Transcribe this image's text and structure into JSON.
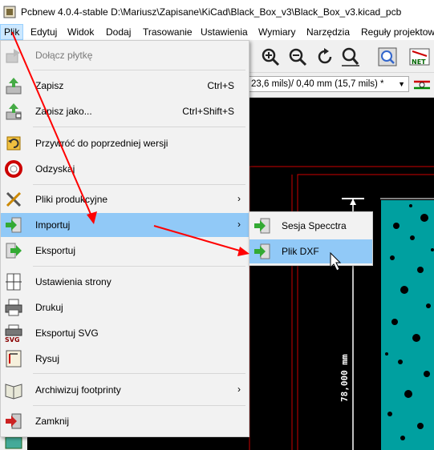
{
  "window": {
    "title": "Pcbnew 4.0.4-stable D:\\Mariusz\\Zapisane\\KiCad\\Black_Box_v3\\Black_Box_v3.kicad_pcb"
  },
  "menubar": [
    {
      "label": "Plik",
      "active": true
    },
    {
      "label": "Edytuj"
    },
    {
      "label": "Widok"
    },
    {
      "label": "Dodaj"
    },
    {
      "label": "Trasowanie"
    },
    {
      "label": "Ustawienia"
    },
    {
      "label": "Wymiary"
    },
    {
      "label": "Narzędzia"
    },
    {
      "label": "Reguły projektowe"
    }
  ],
  "toolbar": {
    "track_width_value": "23,6 mils)/ 0,40 mm (15,7 mils) *"
  },
  "file_menu": {
    "items": [
      {
        "label": "Dołącz płytkę",
        "icon": "append-board-icon",
        "disabled": true
      },
      {
        "label": "Zapisz",
        "shortcut": "Ctrl+S",
        "icon": "save-icon"
      },
      {
        "label": "Zapisz jako...",
        "shortcut": "Ctrl+Shift+S",
        "icon": "save-as-icon"
      },
      {
        "label": "Przywróć do poprzedniej wersji",
        "icon": "revert-icon"
      },
      {
        "label": "Odzyskaj",
        "icon": "rescue-icon"
      },
      {
        "label": "Pliki produkcyjne",
        "icon": "tools-icon",
        "submenu": true
      },
      {
        "label": "Importuj",
        "icon": "import-icon",
        "submenu": true,
        "highlighted": true
      },
      {
        "label": "Eksportuj",
        "icon": "export-icon"
      },
      {
        "label": "Ustawienia strony",
        "icon": "page-settings-icon"
      },
      {
        "label": "Drukuj",
        "icon": "print-icon"
      },
      {
        "label": "Eksportuj SVG",
        "icon": "svg-export-icon"
      },
      {
        "label": "Rysuj",
        "icon": "plot-icon"
      },
      {
        "label": "Archiwizuj footprinty",
        "icon": "archive-icon",
        "submenu": true
      },
      {
        "label": "Zamknij",
        "icon": "exit-icon"
      }
    ]
  },
  "import_submenu": {
    "items": [
      {
        "label": "Sesja Specctra",
        "icon": "specctra-import-icon"
      },
      {
        "label": "Plik DXF",
        "icon": "dxf-import-icon",
        "highlighted": true
      }
    ]
  },
  "canvas": {
    "dimension_label": "78,000 mm"
  },
  "colors": {
    "menu_highlight": "#91c9f7",
    "annotation_arrow": "#ff0000",
    "pcb_copper": "#00a0a0",
    "pcb_outline": "#cc0000"
  }
}
